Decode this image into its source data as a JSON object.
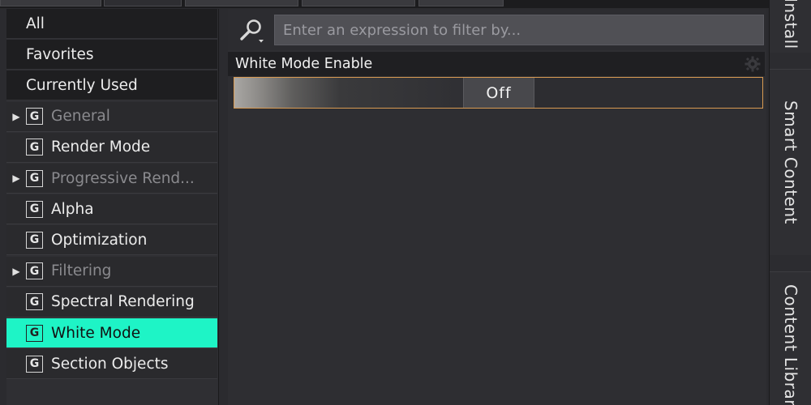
{
  "sidebar": {
    "top_items": [
      {
        "label": "All"
      },
      {
        "label": "Favorites"
      },
      {
        "label": "Currently Used"
      }
    ],
    "groups": [
      {
        "label": "General",
        "expandable": true,
        "dim": true,
        "selected": false
      },
      {
        "label": "Render Mode",
        "expandable": false,
        "dim": false,
        "selected": false
      },
      {
        "label": "Progressive Rend...",
        "expandable": true,
        "dim": true,
        "selected": false
      },
      {
        "label": "Alpha",
        "expandable": false,
        "dim": false,
        "selected": false
      },
      {
        "label": "Optimization",
        "expandable": false,
        "dim": false,
        "selected": false
      },
      {
        "label": "Filtering",
        "expandable": true,
        "dim": true,
        "selected": false
      },
      {
        "label": "Spectral Rendering",
        "expandable": false,
        "dim": false,
        "selected": false
      },
      {
        "label": "White Mode",
        "expandable": false,
        "dim": false,
        "selected": true
      },
      {
        "label": "Section Objects",
        "expandable": false,
        "dim": false,
        "selected": false
      }
    ],
    "group_icon_letter": "G",
    "expand_glyph": "▶"
  },
  "search": {
    "placeholder": "Enter an expression to filter by..."
  },
  "property": {
    "label": "White Mode Enable",
    "value": "Off"
  },
  "right_tabs": {
    "install": "Install",
    "smart_content": "Smart Content",
    "content_library": "Content Library"
  },
  "colors": {
    "selection_accent": "#1ef4c6",
    "toggle_border": "#d89a52"
  }
}
